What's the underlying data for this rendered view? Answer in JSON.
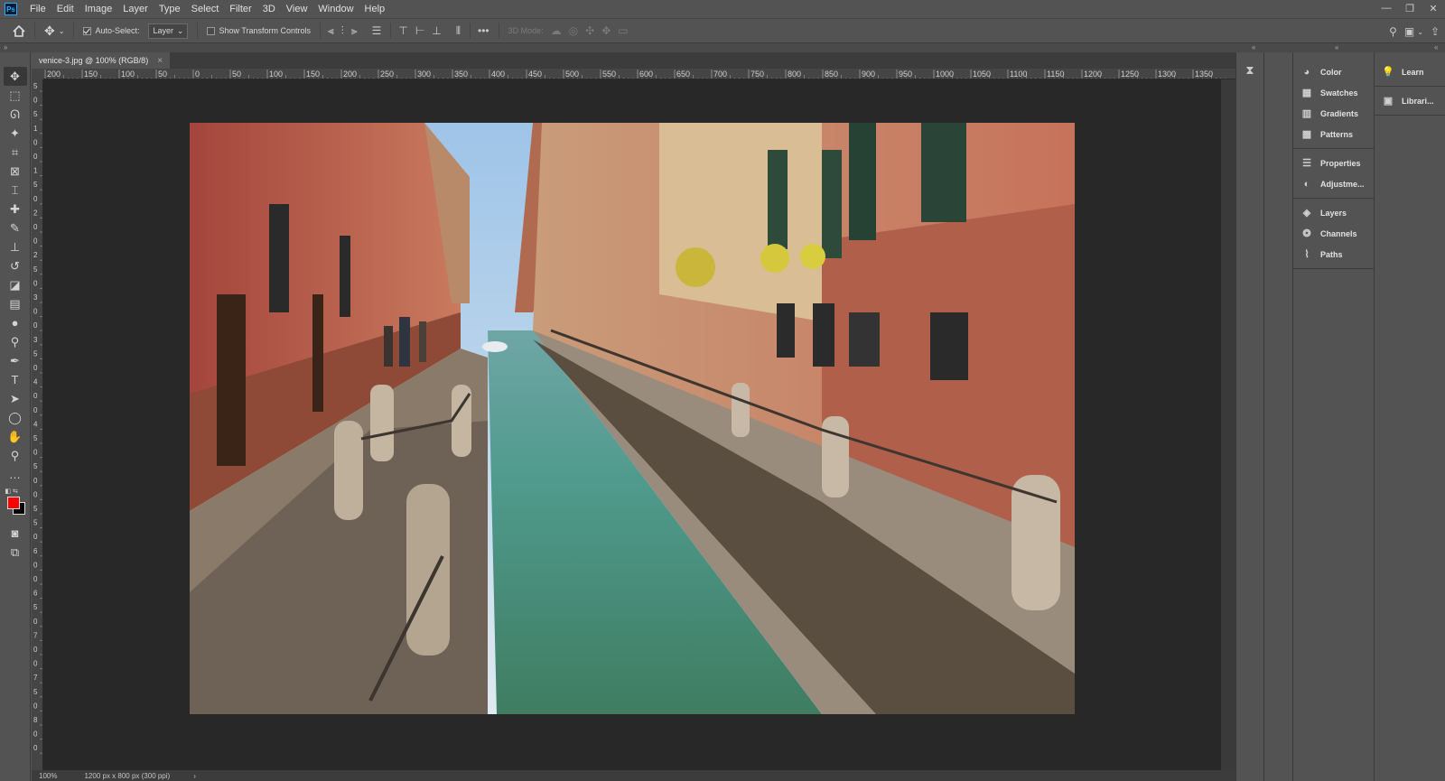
{
  "app": {
    "logo": "Ps"
  },
  "menu": [
    "File",
    "Edit",
    "Image",
    "Layer",
    "Type",
    "Select",
    "Filter",
    "3D",
    "View",
    "Window",
    "Help"
  ],
  "window_controls": {
    "minimize": "—",
    "restore": "❐",
    "close": "✕"
  },
  "options": {
    "auto_select_label": "Auto-Select:",
    "auto_select_checked": true,
    "target_value": "Layer",
    "transform_label": "Show Transform Controls",
    "transform_checked": false,
    "more": "•••",
    "mode_3d_label": "3D Mode:"
  },
  "document": {
    "tab_title": "venice-3.jpg @ 100% (RGB/8)",
    "tab_close": "×",
    "zoom": "100%",
    "info": "1200 px x 800 px (300 ppi)",
    "status_arrow": "›"
  },
  "ruler": {
    "h_ticks": [
      "200",
      "150",
      "100",
      "50",
      "0",
      "50",
      "100",
      "150",
      "200",
      "250",
      "300",
      "350",
      "400",
      "450",
      "500",
      "550",
      "600",
      "650",
      "700",
      "750",
      "800",
      "850",
      "900",
      "950",
      "1000",
      "1050",
      "1100",
      "1150",
      "1200",
      "1250",
      "1300",
      "1350"
    ],
    "v_ticks": [
      "5",
      "0",
      "5",
      "1",
      "0",
      "0",
      "1",
      "5",
      "0",
      "2",
      "0",
      "0",
      "2",
      "5",
      "0",
      "3",
      "0",
      "0",
      "3",
      "5",
      "0",
      "4",
      "0",
      "0",
      "4",
      "5",
      "0",
      "5",
      "0",
      "0",
      "5",
      "5",
      "0",
      "6",
      "0",
      "0",
      "6",
      "5",
      "0",
      "7",
      "0",
      "0",
      "7",
      "5",
      "0",
      "8",
      "0",
      "0"
    ]
  },
  "tools": [
    {
      "name": "move-tool",
      "glyph": "✥"
    },
    {
      "name": "marquee-tool",
      "glyph": "⬚"
    },
    {
      "name": "lasso-tool",
      "glyph": "ᘏ"
    },
    {
      "name": "magic-wand-tool",
      "glyph": "✦"
    },
    {
      "name": "crop-tool",
      "glyph": "⌗"
    },
    {
      "name": "frame-tool",
      "glyph": "⊠"
    },
    {
      "name": "eyedropper-tool",
      "glyph": "⌶"
    },
    {
      "name": "healing-brush-tool",
      "glyph": "✚"
    },
    {
      "name": "brush-tool",
      "glyph": "✎"
    },
    {
      "name": "clone-stamp-tool",
      "glyph": "⊥"
    },
    {
      "name": "history-brush-tool",
      "glyph": "↺"
    },
    {
      "name": "eraser-tool",
      "glyph": "◪"
    },
    {
      "name": "gradient-tool",
      "glyph": "▤"
    },
    {
      "name": "blur-tool",
      "glyph": "●"
    },
    {
      "name": "dodge-tool",
      "glyph": "⚲"
    },
    {
      "name": "pen-tool",
      "glyph": "✒"
    },
    {
      "name": "type-tool",
      "glyph": "T"
    },
    {
      "name": "path-selection-tool",
      "glyph": "➤"
    },
    {
      "name": "ellipse-tool",
      "glyph": "◯"
    },
    {
      "name": "hand-tool",
      "glyph": "✋"
    },
    {
      "name": "zoom-tool",
      "glyph": "⚲"
    },
    {
      "name": "more-tools",
      "glyph": "…"
    }
  ],
  "colors": {
    "foreground": "#ff0000",
    "background": "#000000"
  },
  "panels_primary": [
    [
      {
        "name": "color",
        "label": "Color",
        "glyph": "◕"
      },
      {
        "name": "swatches",
        "label": "Swatches",
        "glyph": "▦"
      },
      {
        "name": "gradients",
        "label": "Gradients",
        "glyph": "▥"
      },
      {
        "name": "patterns",
        "label": "Patterns",
        "glyph": "▩"
      }
    ],
    [
      {
        "name": "properties",
        "label": "Properties",
        "glyph": "☰"
      },
      {
        "name": "adjustments",
        "label": "Adjustme...",
        "glyph": "◐"
      }
    ],
    [
      {
        "name": "layers",
        "label": "Layers",
        "glyph": "◈"
      },
      {
        "name": "channels",
        "label": "Channels",
        "glyph": "❂"
      },
      {
        "name": "paths",
        "label": "Paths",
        "glyph": "⌇"
      }
    ]
  ],
  "panels_secondary": [
    {
      "name": "learn",
      "label": "Learn",
      "glyph": "💡"
    },
    {
      "name": "libraries",
      "label": "Librari...",
      "glyph": "▣"
    }
  ]
}
